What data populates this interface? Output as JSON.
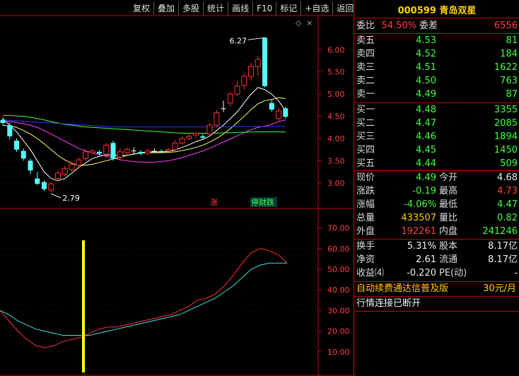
{
  "toolbar": [
    "复权",
    "叠加",
    "多股",
    "统计",
    "画线",
    "F10",
    "标记",
    "+自选",
    "返回"
  ],
  "chart_data": [
    {
      "type": "candlestick",
      "y_ticks": [
        "6.00",
        "5.50",
        "5.00",
        "4.50",
        "4.00",
        "3.50",
        "3.00"
      ],
      "ylim": [
        2.6,
        6.45
      ],
      "high_label": "6.27",
      "high_value": 6.27,
      "low_label": "2.79",
      "low_value": 2.79,
      "candles": [
        {
          "o": 4.42,
          "c": 4.35,
          "h": 4.48,
          "l": 4.28
        },
        {
          "o": 4.3,
          "c": 4.05,
          "h": 4.35,
          "l": 3.98
        },
        {
          "o": 3.95,
          "c": 3.75,
          "h": 4.0,
          "l": 3.7
        },
        {
          "o": 3.72,
          "c": 3.55,
          "h": 3.78,
          "l": 3.5
        },
        {
          "o": 3.5,
          "c": 3.28,
          "h": 3.55,
          "l": 3.2
        },
        {
          "o": 3.1,
          "c": 2.98,
          "h": 3.25,
          "l": 2.95
        },
        {
          "o": 3.02,
          "c": 2.86,
          "h": 3.06,
          "l": 2.82
        },
        {
          "o": 2.84,
          "c": 2.98,
          "h": 3.02,
          "l": 2.79
        },
        {
          "o": 3.1,
          "c": 3.22,
          "h": 3.28,
          "l": 3.05
        },
        {
          "o": 3.2,
          "c": 3.32,
          "h": 3.38,
          "l": 3.15
        },
        {
          "o": 3.3,
          "c": 3.42,
          "h": 3.48,
          "l": 3.25
        },
        {
          "o": 3.4,
          "c": 3.52,
          "h": 3.58,
          "l": 3.36
        },
        {
          "o": 3.55,
          "c": 3.7,
          "h": 3.76,
          "l": 3.5
        },
        {
          "o": 3.68,
          "c": 3.72,
          "h": 3.76,
          "l": 3.64
        },
        {
          "o": 3.7,
          "c": 3.66,
          "h": 3.74,
          "l": 3.62
        },
        {
          "o": 3.65,
          "c": 3.85,
          "h": 3.9,
          "l": 3.55
        },
        {
          "o": 3.9,
          "c": 3.55,
          "h": 3.95,
          "l": 3.5
        },
        {
          "o": 3.58,
          "c": 3.7,
          "h": 3.78,
          "l": 3.52
        },
        {
          "o": 3.68,
          "c": 3.75,
          "h": 3.8,
          "l": 3.62
        },
        {
          "o": 3.73,
          "c": 3.73,
          "h": 3.8,
          "l": 3.65
        },
        {
          "o": 3.7,
          "c": 3.66,
          "h": 3.74,
          "l": 3.62
        },
        {
          "o": 3.67,
          "c": 3.72,
          "h": 3.76,
          "l": 3.64
        },
        {
          "o": 3.72,
          "c": 3.72,
          "h": 3.78,
          "l": 3.68
        },
        {
          "o": 3.72,
          "c": 3.7,
          "h": 3.76,
          "l": 3.68
        },
        {
          "o": 3.72,
          "c": 3.75,
          "h": 3.8,
          "l": 3.7
        },
        {
          "o": 3.75,
          "c": 3.9,
          "h": 3.96,
          "l": 3.72
        },
        {
          "o": 3.9,
          "c": 4.0,
          "h": 4.05,
          "l": 3.86
        },
        {
          "o": 4.0,
          "c": 4.05,
          "h": 4.1,
          "l": 3.96
        },
        {
          "o": 4.08,
          "c": 4.12,
          "h": 4.15,
          "l": 4.02
        },
        {
          "o": 4.05,
          "c": 4.02,
          "h": 4.1,
          "l": 3.98
        },
        {
          "o": 4.1,
          "c": 4.3,
          "h": 4.35,
          "l": 4.05
        },
        {
          "o": 4.3,
          "c": 4.58,
          "h": 4.65,
          "l": 4.25
        },
        {
          "o": 4.68,
          "c": 4.68,
          "h": 4.85,
          "l": 4.6
        },
        {
          "o": 4.8,
          "c": 5.0,
          "h": 5.05,
          "l": 4.72
        },
        {
          "o": 5.0,
          "c": 5.18,
          "h": 5.3,
          "l": 4.95
        },
        {
          "o": 5.2,
          "c": 5.4,
          "h": 5.45,
          "l": 5.1
        },
        {
          "o": 5.4,
          "c": 5.62,
          "h": 5.7,
          "l": 5.3
        },
        {
          "o": 5.62,
          "c": 5.78,
          "h": 5.85,
          "l": 5.4
        },
        {
          "o": 6.27,
          "c": 5.18,
          "h": 6.27,
          "l": 5.15
        },
        {
          "o": 4.8,
          "c": 4.65,
          "h": 4.88,
          "l": 4.6
        },
        {
          "o": 4.45,
          "c": 4.62,
          "h": 4.7,
          "l": 4.4
        },
        {
          "o": 4.68,
          "c": 4.49,
          "h": 4.72,
          "l": 4.44
        }
      ],
      "ma_lines": [
        {
          "color": "#ffffff",
          "values": [
            4.45,
            4.3,
            4.15,
            3.95,
            3.75,
            3.5,
            3.25,
            3.1,
            3.05,
            3.1,
            3.22,
            3.35,
            3.45,
            3.55,
            3.6,
            3.63,
            3.63,
            3.62,
            3.62,
            3.65,
            3.68,
            3.7,
            3.7,
            3.7,
            3.71,
            3.74,
            3.8,
            3.86,
            3.93,
            3.98,
            4.05,
            4.18,
            4.3,
            4.45,
            4.6,
            4.8,
            5.0,
            5.15,
            5.1,
            5.0,
            4.85,
            4.62
          ]
        },
        {
          "color": "#ffff66",
          "values": [
            4.3,
            4.28,
            4.25,
            4.18,
            4.1,
            4.0,
            3.88,
            3.75,
            3.62,
            3.52,
            3.44,
            3.4,
            3.4,
            3.42,
            3.46,
            3.5,
            3.54,
            3.58,
            3.62,
            3.65,
            3.67,
            3.68,
            3.68,
            3.68,
            3.69,
            3.7,
            3.73,
            3.76,
            3.8,
            3.85,
            3.92,
            4.0,
            4.1,
            4.22,
            4.36,
            4.5,
            4.65,
            4.78,
            4.85,
            4.88,
            4.92,
            4.9
          ]
        },
        {
          "color": "#ff40ff",
          "values": [
            4.4,
            4.38,
            4.36,
            4.33,
            4.3,
            4.25,
            4.18,
            4.1,
            4.02,
            3.94,
            3.86,
            3.78,
            3.72,
            3.68,
            3.64,
            3.6,
            3.56,
            3.52,
            3.5,
            3.48,
            3.47,
            3.47,
            3.47,
            3.48,
            3.5,
            3.53,
            3.57,
            3.62,
            3.67,
            3.72,
            3.78,
            3.85,
            3.92,
            3.99,
            4.06,
            4.13,
            4.2,
            4.25,
            4.28,
            4.32,
            4.38,
            4.42
          ]
        },
        {
          "color": "#40ff40",
          "values": [
            4.52,
            4.52,
            4.51,
            4.5,
            4.48,
            4.45,
            4.42,
            4.38,
            4.35,
            4.32,
            4.3,
            4.28,
            4.26,
            4.25,
            4.24,
            4.23,
            4.22,
            4.21,
            4.2,
            4.19,
            4.18,
            4.17,
            4.16,
            4.15,
            4.14,
            4.13,
            4.12,
            4.12,
            4.12,
            4.12,
            4.12,
            4.12,
            4.13,
            4.13,
            4.14,
            4.14,
            4.15,
            4.15,
            4.15,
            4.15,
            4.15,
            4.15
          ]
        },
        {
          "color": "#3333ff",
          "values": [
            4.42,
            4.41,
            4.4,
            4.39,
            4.38,
            4.37,
            4.36,
            4.35,
            4.34,
            4.33,
            4.32,
            4.31,
            4.3,
            4.29,
            4.28,
            4.27,
            4.26,
            4.26,
            4.26,
            4.26,
            4.26,
            4.26,
            4.26,
            4.26,
            4.26,
            4.26,
            4.26,
            4.26,
            4.26,
            4.26,
            4.26,
            4.26,
            4.26,
            4.26,
            4.27,
            4.27,
            4.27,
            4.27,
            4.27,
            4.27,
            4.27,
            4.27
          ]
        }
      ],
      "signals": [
        {
          "text": "涨",
          "color": "#ff4040"
        },
        {
          "text": "停财跌",
          "color": "#40ff40"
        }
      ]
    },
    {
      "type": "line",
      "y_ticks": [
        "70.00",
        "60.00",
        "50.00",
        "40.00",
        "30.00",
        "20.00",
        "10.00"
      ],
      "ylim": [
        0,
        75
      ],
      "series": [
        {
          "color": "#ff3030",
          "values": [
            30,
            25,
            20,
            16,
            13,
            12,
            13,
            15,
            16,
            17,
            19,
            21,
            22,
            22,
            23,
            24,
            25,
            26,
            27,
            28,
            30,
            32,
            35,
            36,
            38,
            42,
            47,
            53,
            58,
            60,
            59,
            57,
            53
          ]
        },
        {
          "color": "#40e0e0",
          "values": [
            30,
            28,
            25,
            23,
            21,
            20,
            19,
            18,
            18,
            18,
            18,
            19,
            20,
            21,
            22,
            23,
            24,
            25,
            26,
            27,
            28,
            30,
            32,
            34,
            36,
            39,
            42,
            46,
            50,
            52,
            53,
            53,
            53
          ]
        }
      ],
      "marker_index": 9,
      "marker_color": "#ffff00"
    }
  ],
  "quote": {
    "code": "000599",
    "name": "青岛双星",
    "weibi_label": "委比",
    "weibi": "54.50%",
    "weicha_label": "委差",
    "weicha": "6556",
    "asks": [
      {
        "label": "卖五",
        "price": "4.53",
        "vol": "81"
      },
      {
        "label": "卖四",
        "price": "4.52",
        "vol": "184"
      },
      {
        "label": "卖三",
        "price": "4.51",
        "vol": "1622"
      },
      {
        "label": "卖二",
        "price": "4.50",
        "vol": "763"
      },
      {
        "label": "卖一",
        "price": "4.49",
        "vol": "87"
      }
    ],
    "bids": [
      {
        "label": "买一",
        "price": "4.48",
        "vol": "3355"
      },
      {
        "label": "买二",
        "price": "4.47",
        "vol": "2085"
      },
      {
        "label": "买三",
        "price": "4.46",
        "vol": "1894"
      },
      {
        "label": "买四",
        "price": "4.45",
        "vol": "1450"
      },
      {
        "label": "买五",
        "price": "4.44",
        "vol": "509"
      }
    ],
    "stats": [
      {
        "l1": "现价",
        "v1": "4.49",
        "c1": "c-green",
        "l2": "今开",
        "v2": "4.68",
        "c2": "c-white"
      },
      {
        "l1": "涨跌",
        "v1": "-0.19",
        "c1": "c-green",
        "l2": "最高",
        "v2": "4.73",
        "c2": "c-red"
      },
      {
        "l1": "涨幅",
        "v1": "-4.06%",
        "c1": "c-green",
        "l2": "最低",
        "v2": "4.47",
        "c2": "c-green"
      },
      {
        "l1": "总量",
        "v1": "433507",
        "c1": "c-yellow",
        "l2": "量比",
        "v2": "0.82",
        "c2": "c-green"
      },
      {
        "l1": "外盘",
        "v1": "192261",
        "c1": "c-red",
        "l2": "内盘",
        "v2": "241246",
        "c2": "c-green"
      }
    ],
    "stats2": [
      {
        "l1": "换手",
        "v1": "5.31%",
        "l2": "股本",
        "v2": "8.17亿"
      },
      {
        "l1": "净资",
        "v1": "2.61",
        "l2": "流通",
        "v2": "8.17亿"
      },
      {
        "l1": "收益⑷",
        "v1": "-0.220",
        "l2": "PE(动)",
        "v2": "-"
      }
    ],
    "promo_text": "自动续费通达信普及版",
    "promo_price": "30元/月",
    "status": "行情连接已断开"
  }
}
